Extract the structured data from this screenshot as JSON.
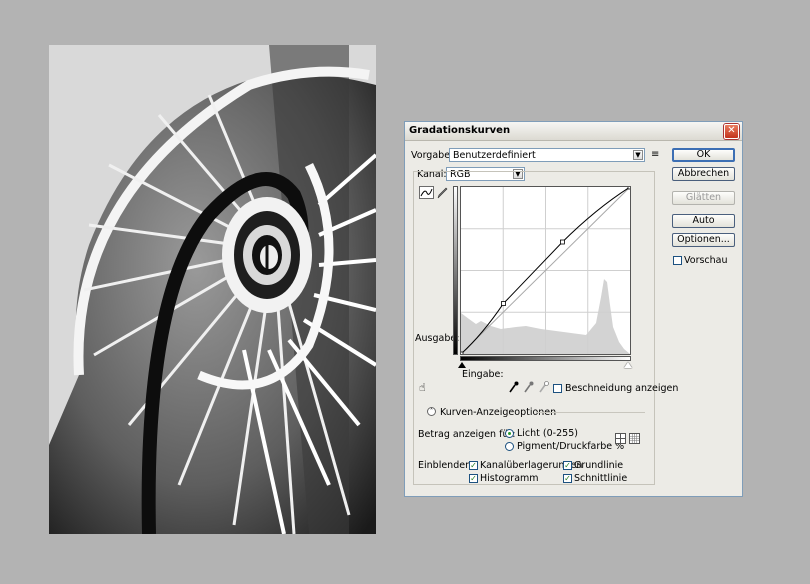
{
  "dialog": {
    "title": "Gradationskurven",
    "close_icon": "close-icon",
    "preset_label": "Vorgabe:",
    "preset_value": "Benutzerdefiniert",
    "channel_label": "Kanal:",
    "channel_value": "RGB",
    "output_label": "Ausgabe:",
    "input_label": "Eingabe:",
    "clipping_label": "Beschneidung anzeigen",
    "curve_options_label": "Kurven-Anzeigeoptionen",
    "amount_label": "Betrag anzeigen für:",
    "radio_light": "Licht (0-255)",
    "radio_pigment": "Pigment/Druckfarbe %",
    "show_label": "Einblenden:",
    "check_channel_overlays": "Kanalüberlagerungen",
    "check_baseline": "Grundlinie",
    "check_histogram": "Histogramm",
    "check_intersection": "Schnittlinie",
    "buttons": {
      "ok": "OK",
      "cancel": "Abbrechen",
      "smooth": "Glätten",
      "auto": "Auto",
      "options": "Optionen..."
    },
    "preview_label": "Vorschau",
    "state": {
      "light_selected": true,
      "pigment_selected": false,
      "channel_overlays": true,
      "baseline": true,
      "histogram": true,
      "intersection": true,
      "preview": false
    }
  },
  "curve_points": [
    {
      "input": 0,
      "output": 0
    },
    {
      "input": 64,
      "output": 77
    },
    {
      "input": 153,
      "output": 171
    },
    {
      "input": 255,
      "output": 255
    }
  ],
  "colors": {
    "background": "#b3b3b3",
    "dialog": "#ecebe6",
    "close_button": "#c3321c",
    "default_button_border": "#3c6fb4"
  },
  "photo": {
    "description_icon": "spiral-staircase-photo"
  }
}
